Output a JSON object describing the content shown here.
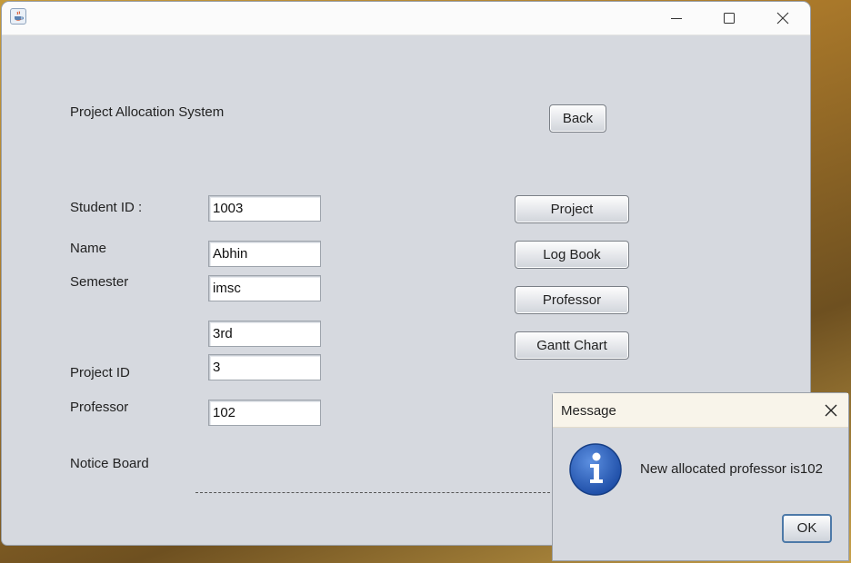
{
  "window": {
    "icon": "java-app-icon",
    "controls": [
      "minimize-icon",
      "maximize-icon",
      "close-icon"
    ]
  },
  "form": {
    "title": "Project Allocation System",
    "back_label": "Back",
    "labels": {
      "student_id": "Student ID :",
      "name": "Name",
      "semester": "Semester",
      "project_id": "Project ID",
      "professor": "Professor",
      "notice_board": "Notice Board"
    },
    "values": {
      "student_id": "1003",
      "name": "Abhin",
      "course": "imsc",
      "semester": "3rd",
      "project_id": "3",
      "professor": "102"
    },
    "buttons": {
      "project": "Project",
      "log_book": "Log Book",
      "professor": "Professor",
      "gantt_chart": "Gantt Chart"
    }
  },
  "dialog": {
    "title": "Message",
    "message": "New allocated professor is102",
    "ok_label": "OK",
    "icon": "info-icon"
  }
}
